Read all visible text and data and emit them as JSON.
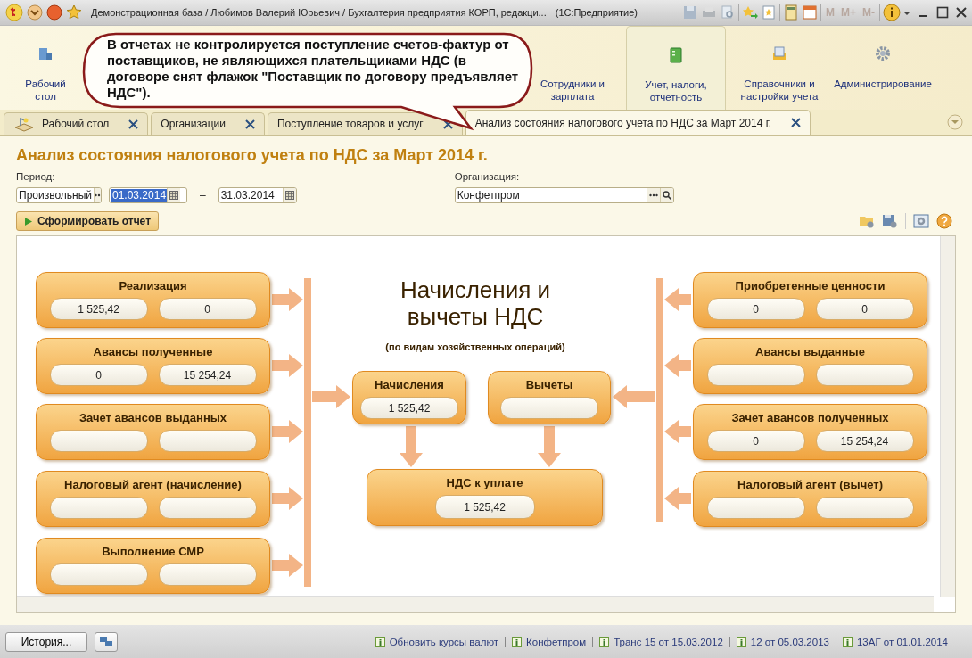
{
  "window": {
    "title": "Демонстрационная база / Любимов Валерий Юрьевич / Бухгалтерия предприятия КОРП, редакци...",
    "app": "(1С:Предприятие)",
    "memory_buttons": [
      "M",
      "M+",
      "M-"
    ]
  },
  "sections": [
    {
      "label": "Рабочий стол",
      "selected": false
    },
    {
      "label": "Сотрудники и зарплата",
      "selected": false
    },
    {
      "label": "Учет, налоги, отчетность",
      "selected": true
    },
    {
      "label": "Справочники и настройки учета",
      "selected": false
    },
    {
      "label": "Администрирование",
      "selected": false
    }
  ],
  "callout": {
    "text": "В отчетах не контролируется поступление счетов-фактур от поставщиков, не являющихся плательщиками НДС (в договоре снят флажок \"Поставщик по договору предъявляет НДС\")."
  },
  "tabs": [
    {
      "label": "Рабочий стол",
      "selected": false
    },
    {
      "label": "Организации",
      "selected": false
    },
    {
      "label": "Поступление товаров и услуг",
      "selected": false
    },
    {
      "label": "Анализ состояния налогового учета по НДС за Март 2014 г.",
      "selected": true
    }
  ],
  "report": {
    "title": "Анализ состояния налогового учета по НДС за Март 2014 г.",
    "period_label": "Период:",
    "period_kind": "Произвольный",
    "date_from": {
      "value": "01.03.2014",
      "highlighted": true
    },
    "dash": "–",
    "date_to": {
      "value": "31.03.2014",
      "highlighted": false
    },
    "org_label": "Организация:",
    "org": "Конфетпром",
    "run_button": "Сформировать отчет"
  },
  "diagram": {
    "title": "Начисления и вычеты НДС",
    "subtitle": "(по видам хозяйственных операций)",
    "left": [
      {
        "title": "Реализация",
        "values": [
          "1 525,42",
          "0"
        ]
      },
      {
        "title": "Авансы полученные",
        "values": [
          "0",
          "15 254,24"
        ]
      },
      {
        "title": "Зачет авансов выданных"
      },
      {
        "title": "Налоговый агент (начисление)"
      },
      {
        "title": "Выполнение СМР"
      }
    ],
    "right": [
      {
        "title": "Приобретенные ценности",
        "values": [
          "0",
          "0"
        ]
      },
      {
        "title": "Авансы выданные"
      },
      {
        "title": "Зачет авансов полученных",
        "values": [
          "0",
          "15 254,24"
        ]
      },
      {
        "title": "Налоговый агент (вычет)"
      }
    ],
    "accruals": {
      "title": "Начисления",
      "value": "1 525,42"
    },
    "deductions": {
      "title": "Вычеты"
    },
    "payable": {
      "title": "НДС к уплате",
      "value": "1 525,42"
    }
  },
  "status_bar": {
    "history_button": "История...",
    "links": [
      "Обновить курсы валют",
      "Конфетпром",
      "Транс 15 от 15.03.2012",
      "12 от 05.03.2013",
      "13АГ от 01.01.2014"
    ]
  }
}
